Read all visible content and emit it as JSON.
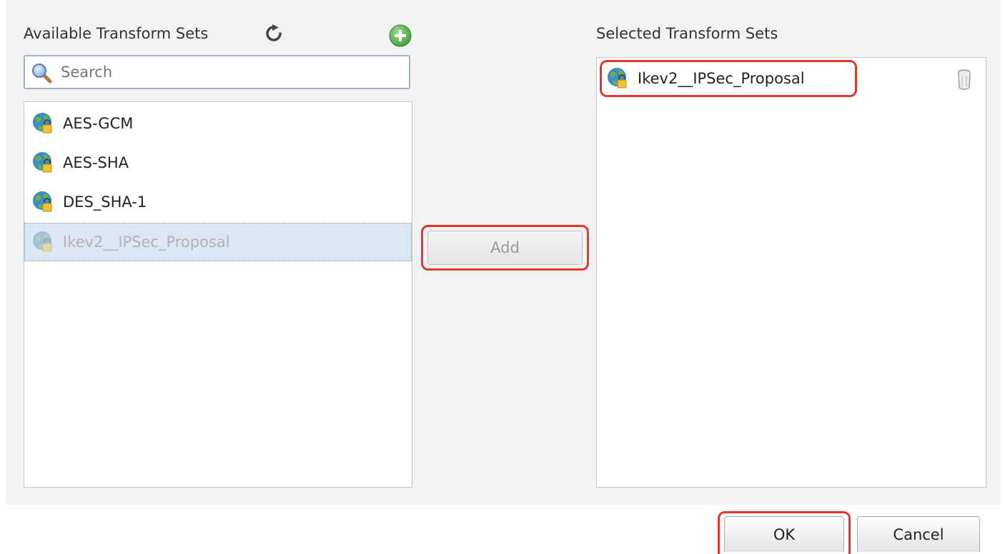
{
  "available": {
    "title": "Available Transform Sets",
    "search_placeholder": "Search",
    "items": [
      {
        "label": "AES-GCM",
        "disabled": false
      },
      {
        "label": "AES-SHA",
        "disabled": false
      },
      {
        "label": "DES_SHA-1",
        "disabled": false
      },
      {
        "label": "Ikev2__IPSec_Proposal",
        "disabled": true
      }
    ]
  },
  "selected": {
    "title": "Selected Transform Sets",
    "items": [
      {
        "label": "Ikev2__IPSec_Proposal"
      }
    ]
  },
  "buttons": {
    "add_label": "Add",
    "ok_label": "OK",
    "cancel_label": "Cancel"
  },
  "icons": {
    "refresh": "refresh-icon",
    "add": "add-circle-icon",
    "search": "search-icon",
    "transform_set": "vpn-globe-lock-icon",
    "delete": "trash-icon"
  },
  "colors": {
    "highlight": "#e5372d",
    "add_green": "#5cb85c",
    "selected_row": "#dde6f3"
  }
}
